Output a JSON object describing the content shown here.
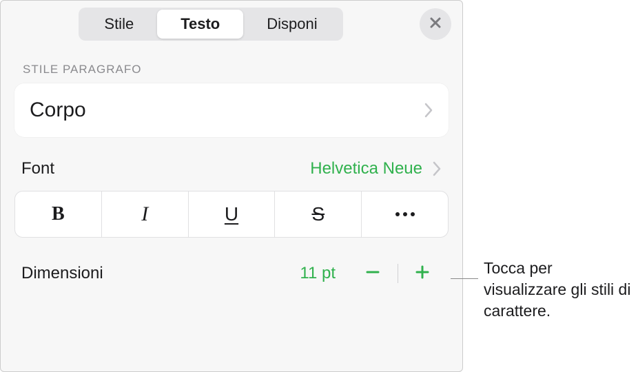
{
  "tabs": {
    "style": "Stile",
    "text": "Testo",
    "arrange": "Disponi"
  },
  "section": {
    "heading": "STILE PARAGRAFO"
  },
  "paragraph_style": {
    "value": "Corpo"
  },
  "font": {
    "label": "Font",
    "value": "Helvetica Neue"
  },
  "style_buttons": {
    "bold": "B",
    "italic": "I",
    "underline": "U",
    "strike": "S"
  },
  "size": {
    "label": "Dimensioni",
    "value": "11 pt"
  },
  "callout": {
    "text": "Tocca per visualizzare gli stili di carattere."
  },
  "colors": {
    "accent": "#30b14d"
  }
}
